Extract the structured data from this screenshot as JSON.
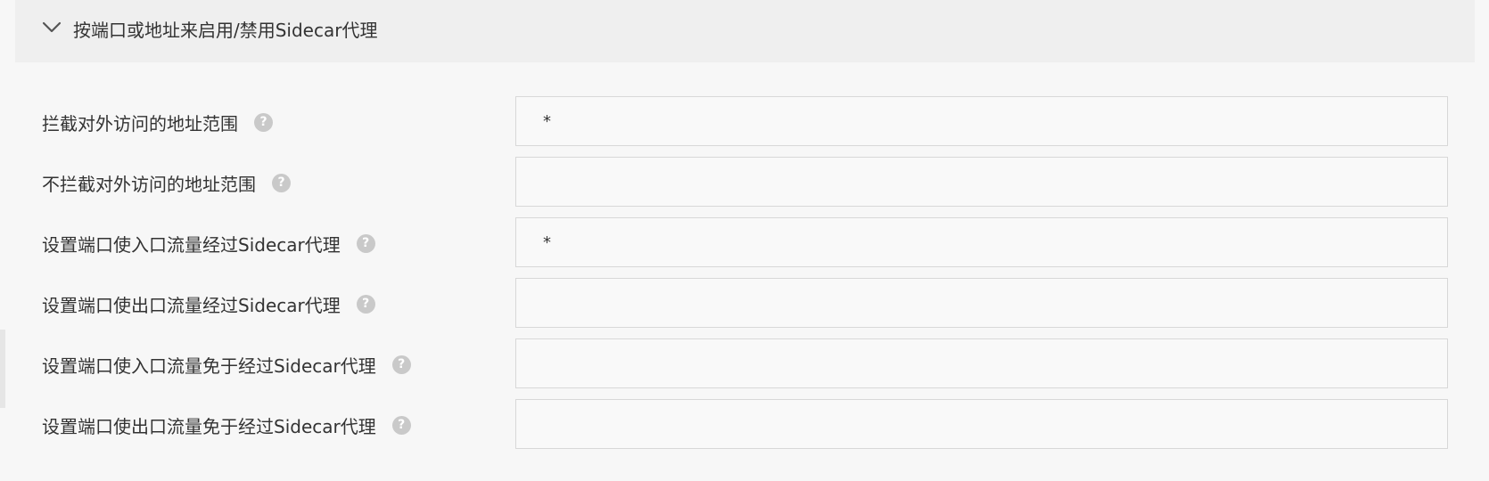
{
  "panel": {
    "title": "按端口或地址来启用/禁用Sidecar代理",
    "expanded": true
  },
  "fields": [
    {
      "label": "拦截对外访问的地址范围",
      "value": "*",
      "help_icon": "question-circle-icon"
    },
    {
      "label": "不拦截对外访问的地址范围",
      "value": "",
      "help_icon": "question-circle-icon"
    },
    {
      "label": "设置端口使入口流量经过Sidecar代理",
      "value": "*",
      "help_icon": "question-circle-icon"
    },
    {
      "label": "设置端口使出口流量经过Sidecar代理",
      "value": "",
      "help_icon": "question-circle-icon"
    },
    {
      "label": "设置端口使入口流量免于经过Sidecar代理",
      "value": "",
      "help_icon": "question-circle-icon"
    },
    {
      "label": "设置端口使出口流量免于经过Sidecar代理",
      "value": "",
      "help_icon": "question-circle-icon"
    }
  ],
  "colors": {
    "header_bg": "#efefef",
    "page_bg": "#f7f7f7",
    "input_border": "#d8d8d8",
    "help_icon": "#c9c9c9"
  }
}
